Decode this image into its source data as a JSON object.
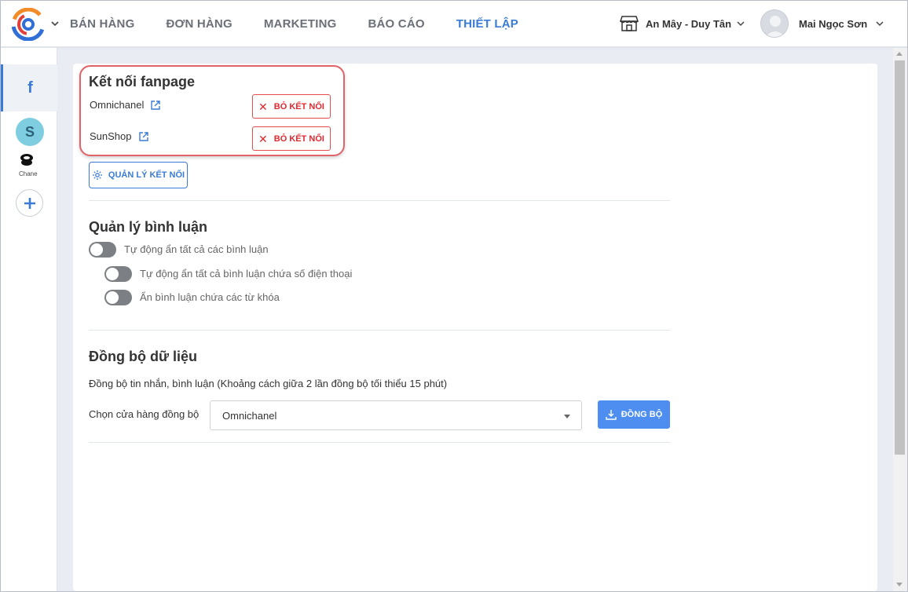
{
  "topbar": {
    "logo_icon": "app-logo-icon",
    "nav": [
      {
        "label": "BÁN HÀNG",
        "active": false
      },
      {
        "label": "ĐƠN HÀNG",
        "active": false
      },
      {
        "label": "MARKETING",
        "active": false
      },
      {
        "label": "BÁO CÁO",
        "active": false
      },
      {
        "label": "THIẾT LẬP",
        "active": true
      }
    ],
    "store_name": "An Mây - Duy Tân",
    "user_name": "Mai Ngọc Sơn"
  },
  "sidebar": {
    "items": [
      {
        "icon": "facebook-icon",
        "label": "f",
        "active": true
      },
      {
        "icon": "shop-s-icon",
        "label": "S"
      },
      {
        "icon": "chanel-icon",
        "label": "Chane"
      },
      {
        "icon": "plus-icon"
      }
    ]
  },
  "fanpage": {
    "title": "Kết nối fanpage",
    "pages": [
      {
        "name": "Omnichanel",
        "action": "BỎ KẾT NỐI"
      },
      {
        "name": "SunShop",
        "action": "BỎ KẾT NỐI"
      }
    ],
    "manage_label": "QUẢN LÝ KẾT NỐI"
  },
  "comments": {
    "title": "Quản lý bình luận",
    "toggles": [
      {
        "label": "Tự động ẩn tất cả các bình luận",
        "on": false
      },
      {
        "label": "Tự động ẩn tất cả bình luận chứa số điện thoại",
        "on": false
      },
      {
        "label": "Ẩn bình luận chứa các từ khóa",
        "on": false
      }
    ]
  },
  "sync": {
    "title": "Đồng bộ dữ liệu",
    "description": "Đồng bộ tin nhắn, bình luận (Khoảng cách giữa 2 lần đồng bộ tối thiểu 15 phút)",
    "store_label": "Chọn cửa hàng đồng bộ",
    "selected_store": "Omnichanel",
    "sync_button": "ĐỒNG BỘ"
  },
  "colors": {
    "accent": "#3a7bd5",
    "danger": "#e0292f",
    "highlight": "#e0636a",
    "sync_button": "#4d8ef0"
  }
}
